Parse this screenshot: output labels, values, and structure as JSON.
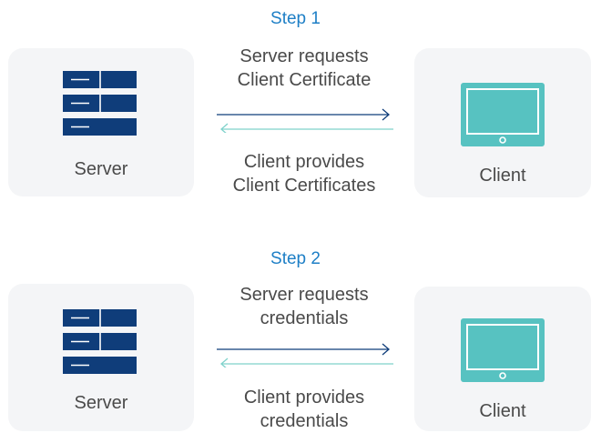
{
  "colors": {
    "step_title": "#1e7fc6",
    "server_icon": "#0f3d7a",
    "client_icon": "#57c2c1",
    "request_arrow": "#0f3d7a",
    "response_arrow": "#7fd2cb",
    "panel_bg": "#f4f5f7",
    "text": "#4a4a4a"
  },
  "icons": {
    "server": "server-rack-icon",
    "client": "monitor-icon"
  },
  "steps": [
    {
      "title": "Step 1",
      "server_label": "Server",
      "client_label": "Client",
      "request_lines": [
        "Server requests",
        "Client Certificate"
      ],
      "response_lines": [
        "Client provides",
        "Client Certificates"
      ]
    },
    {
      "title": "Step 2",
      "server_label": "Server",
      "client_label": "Client",
      "request_lines": [
        "Server requests",
        "credentials"
      ],
      "response_lines": [
        "Client provides",
        "credentials"
      ]
    }
  ]
}
